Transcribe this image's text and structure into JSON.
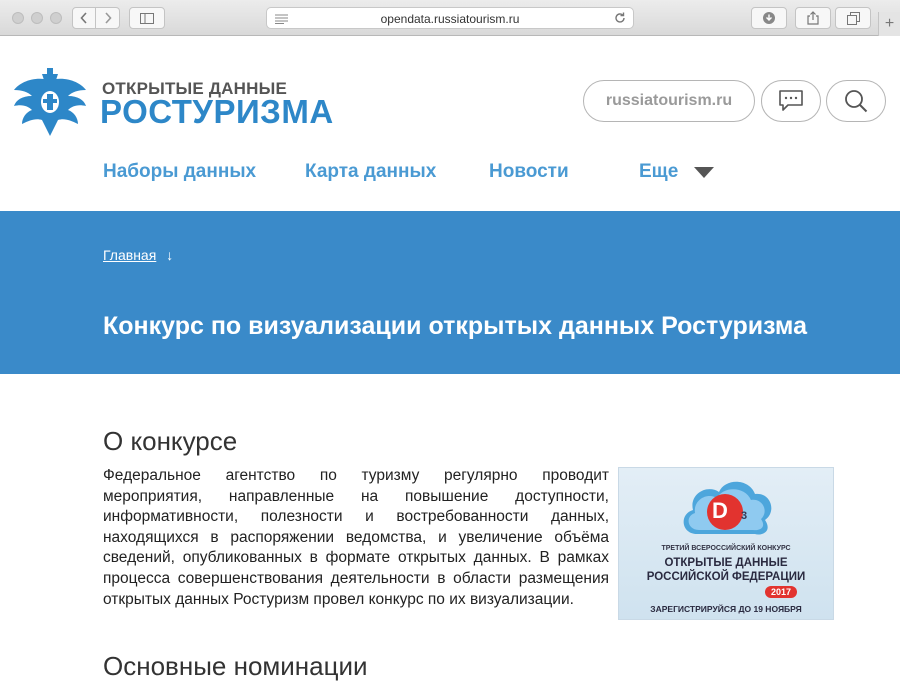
{
  "browser": {
    "url": "opendata.russiatourism.ru",
    "new_tab_label": "+"
  },
  "brand": {
    "top": "ОТКРЫТЫЕ ДАННЫЕ",
    "main": "РОСТУРИЗМА"
  },
  "header": {
    "site_link": "russiatourism.ru"
  },
  "nav": {
    "items": [
      "Наборы данных",
      "Карта данных",
      "Новости"
    ],
    "more": "Еще"
  },
  "hero": {
    "breadcrumb": "Главная",
    "breadcrumb_arrow": "↓",
    "title": "Конкурс по визуализации открытых данных Ростуризма"
  },
  "about": {
    "heading": "О конкурсе",
    "text": "Федеральное агентство по туризму регулярно проводит мероприятия, направленные на повышение доступности, информативности, полезности и востребованности данных, находящихся в распоряжении ведомства, и увеличение объёма сведений, опубликованных в формате открытых данных. В рамках процесса совершенствования деятельности в области размещения открытых данных Ростуризм провел конкурс по их визуализации."
  },
  "promo": {
    "logo_letter": "D",
    "logo_sub": "3",
    "line1": "ТРЕТИЙ ВСЕРОССИЙСКИЙ КОНКУРС",
    "line2": "ОТКРЫТЫЕ ДАННЫЕ",
    "line3": "РОССИЙСКОЙ ФЕДЕРАЦИИ",
    "year": "2017",
    "register": "ЗАРЕГИСТРИРУЙСЯ ДО 19 НОЯБРЯ"
  },
  "nominations": {
    "heading": "Основные номинации"
  },
  "colors": {
    "accent": "#3a8ac9",
    "nav": "#4a9ad3",
    "brand": "#2d87c8"
  }
}
